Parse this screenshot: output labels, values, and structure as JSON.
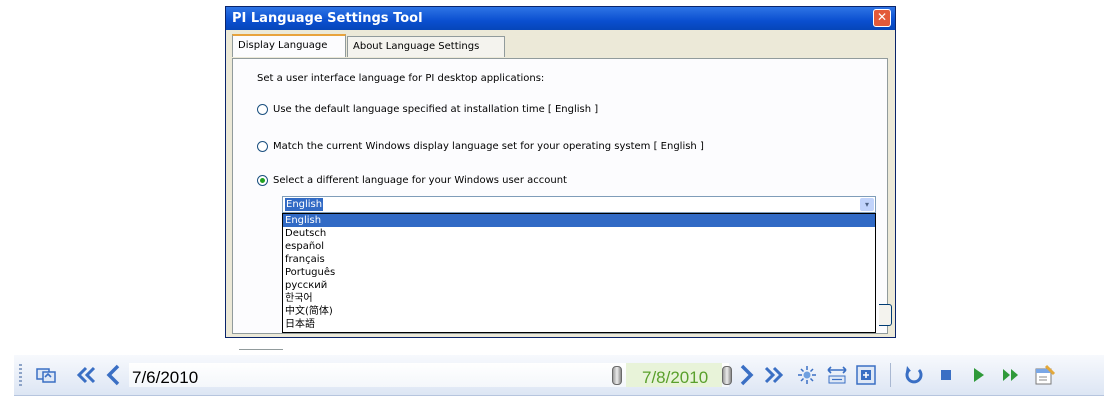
{
  "dialog": {
    "title": "PI Language Settings Tool",
    "close_glyph": "✕",
    "tabs": [
      {
        "label": "Display Language",
        "active": true
      },
      {
        "label": "About Language Settings",
        "active": false
      }
    ],
    "prompt": "Set a user interface language for PI desktop applications:",
    "options": [
      {
        "label": "Use the default language specified at installation time [ English ]",
        "checked": false
      },
      {
        "label": "Match the current Windows display language set for your operating system [ English ]",
        "checked": false
      },
      {
        "label": "Select a different language for your Windows user account",
        "checked": true
      }
    ],
    "combo": {
      "selected": "English",
      "arrow_glyph": "▾",
      "items": [
        "English",
        "Deutsch",
        "español",
        "français",
        "Português",
        "русский",
        "한국어",
        "中文(简体)",
        "日本語"
      ]
    }
  },
  "timebar": {
    "start_time": "7/6/2010",
    "end_time": "7/8/2010",
    "icons": {
      "refresh": "refresh-icon",
      "step_back_far": "double-chevron-left-icon",
      "step_back": "chevron-left-icon",
      "step_forward": "chevron-right-icon",
      "step_forward_far": "double-chevron-right-icon",
      "now": "sun-icon",
      "time_range": "expand-range-icon",
      "zoom": "zoom-icon",
      "reset": "reset-icon",
      "stop": "stop-icon",
      "play": "play-icon",
      "fast_forward": "fast-forward-icon",
      "properties": "properties-icon"
    },
    "colors": {
      "accent": "#3a6fc4",
      "end_time": "#5aa02c"
    }
  }
}
